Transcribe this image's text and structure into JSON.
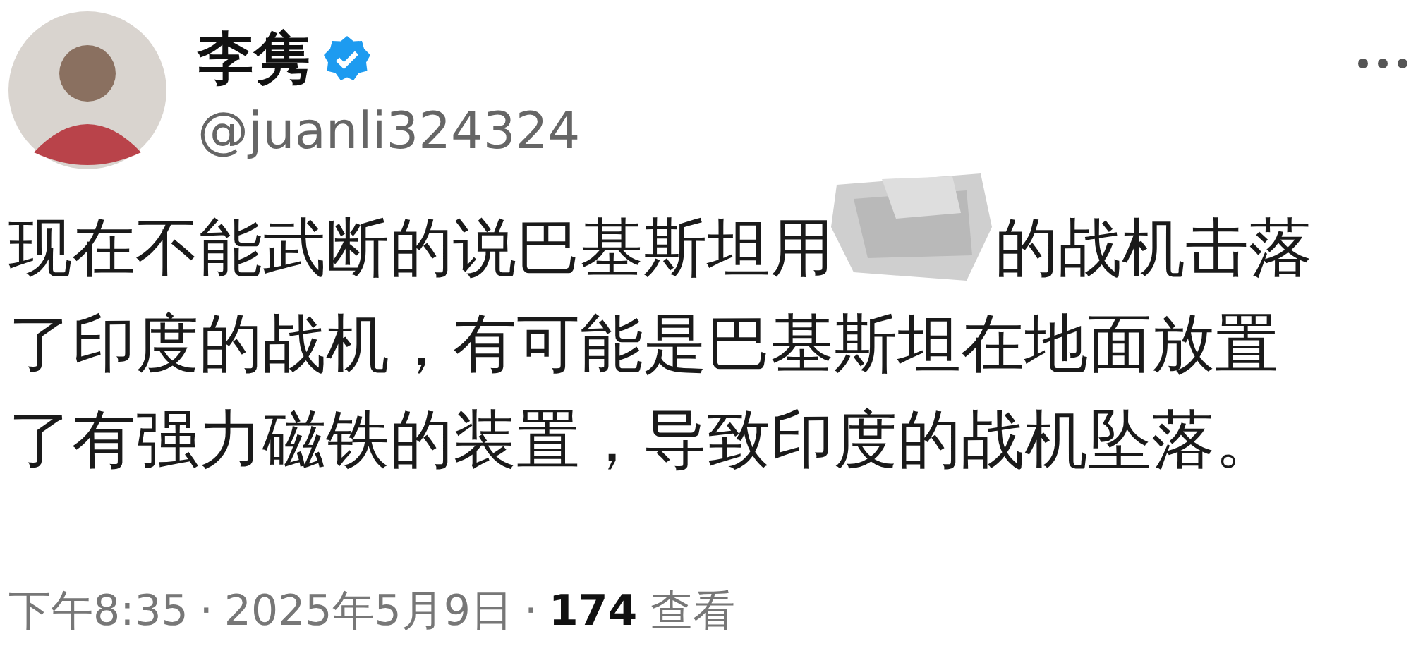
{
  "author": {
    "name": "李隽",
    "verified": true,
    "handle": "@juanli324324"
  },
  "body": [
    {
      "segments": [
        {
          "kind": "text",
          "text": "现在不能武断的说巴基斯坦用"
        },
        {
          "kind": "redaction"
        },
        {
          "kind": "text",
          "text": "的战机击落"
        }
      ]
    },
    {
      "segments": [
        {
          "kind": "text",
          "text": "了印度的战机，有可能是巴基斯坦在地面放置"
        }
      ]
    },
    {
      "segments": [
        {
          "kind": "text",
          "text": "了有强力磁铁的装置，导致印度的战机坠落。"
        }
      ]
    }
  ],
  "footer": {
    "separators": [
      "·",
      "·"
    ],
    "time": "下午8:35",
    "date": "2025年5月9日",
    "views_count": "174",
    "views_label": "查看"
  }
}
